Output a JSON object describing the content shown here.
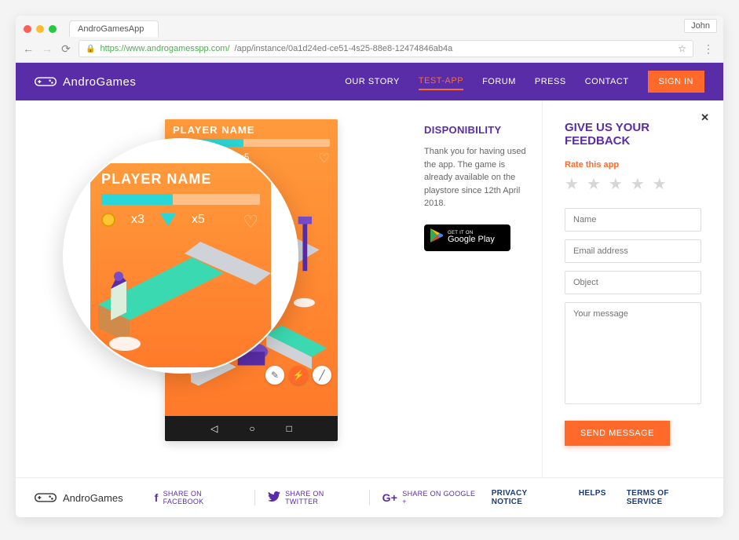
{
  "browser": {
    "tab_title": "AndroGamesApp",
    "user": "John",
    "url_secure_part": "https://www.androgamesspp.com/",
    "url_rest": "/app/instance/0a1d24ed-ce51-4s25-88e8-12474846ab4a"
  },
  "header": {
    "brand": "AndroGames",
    "nav": {
      "our_story": "OUR STORY",
      "test_app": "TEST-APP",
      "forum": "FORUM",
      "press": "PRESS",
      "contact": "CONTACT"
    },
    "signin": "SIGN IN"
  },
  "game": {
    "player_label": "PLAYER NAME",
    "coin_count": "x3",
    "gem_count": "x5"
  },
  "disponibility": {
    "title": "DISPONIBILITY",
    "text": "Thank you for having used the app. The game is already available on the playstore since 12th April 2018.",
    "gplay_small": "GET IT ON",
    "gplay_big": "Google Play"
  },
  "feedback": {
    "title": "GIVE US YOUR FEEDBACK",
    "rate_label": "Rate this app",
    "name_ph": "Name",
    "email_ph": "Email address",
    "object_ph": "Object",
    "message_ph": "Your message",
    "send": "SEND MESSAGE"
  },
  "footer": {
    "brand": "AndroGames",
    "fb": "SHARE ON FACEBOOK",
    "tw": "SHARE ON TWITTER",
    "gp": "SHARE ON GOOGLE +",
    "privacy": "PRIVACY NOTICE",
    "helps": "HELPS",
    "tos": "TERMS OF SERVICE"
  }
}
